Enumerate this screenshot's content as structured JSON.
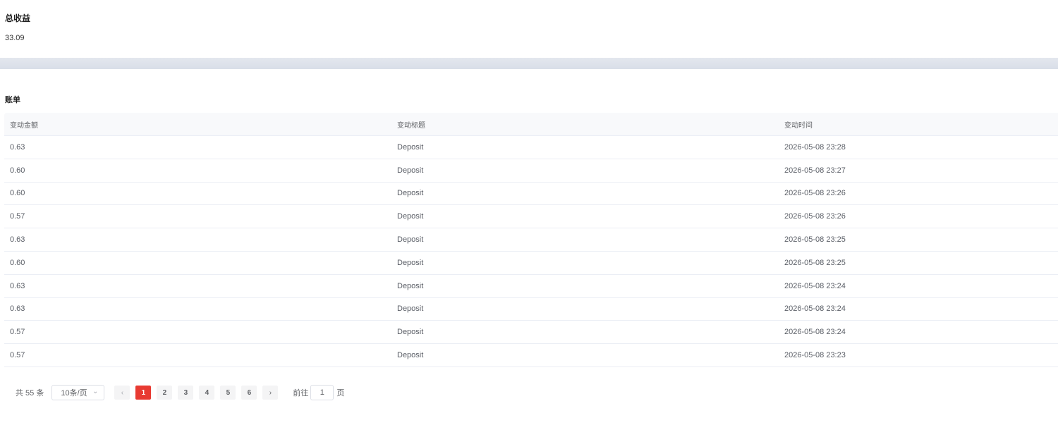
{
  "summary": {
    "title": "总收益",
    "value": "33.09"
  },
  "bill": {
    "title": "账单",
    "columns": [
      "变动金额",
      "变动标题",
      "变动时间"
    ],
    "rows": [
      [
        "0.63",
        "Deposit",
        "2026-05-08 23:28"
      ],
      [
        "0.60",
        "Deposit",
        "2026-05-08 23:27"
      ],
      [
        "0.60",
        "Deposit",
        "2026-05-08 23:26"
      ],
      [
        "0.57",
        "Deposit",
        "2026-05-08 23:26"
      ],
      [
        "0.63",
        "Deposit",
        "2026-05-08 23:25"
      ],
      [
        "0.60",
        "Deposit",
        "2026-05-08 23:25"
      ],
      [
        "0.63",
        "Deposit",
        "2026-05-08 23:24"
      ],
      [
        "0.63",
        "Deposit",
        "2026-05-08 23:24"
      ],
      [
        "0.57",
        "Deposit",
        "2026-05-08 23:24"
      ],
      [
        "0.57",
        "Deposit",
        "2026-05-08 23:23"
      ]
    ]
  },
  "pagination": {
    "total_label": "共 55 条",
    "page_size": "10条/页",
    "pages": [
      "1",
      "2",
      "3",
      "4",
      "5",
      "6"
    ],
    "current_page": "1",
    "prev_icon": "chevron-left-icon",
    "next_icon": "chevron-right-icon",
    "goto_prefix": "前往",
    "goto_value": "1",
    "goto_suffix": "页"
  },
  "colors": {
    "accent": "#e83a32",
    "header_bg": "#f8f9fb",
    "band": "#dde2ea"
  }
}
